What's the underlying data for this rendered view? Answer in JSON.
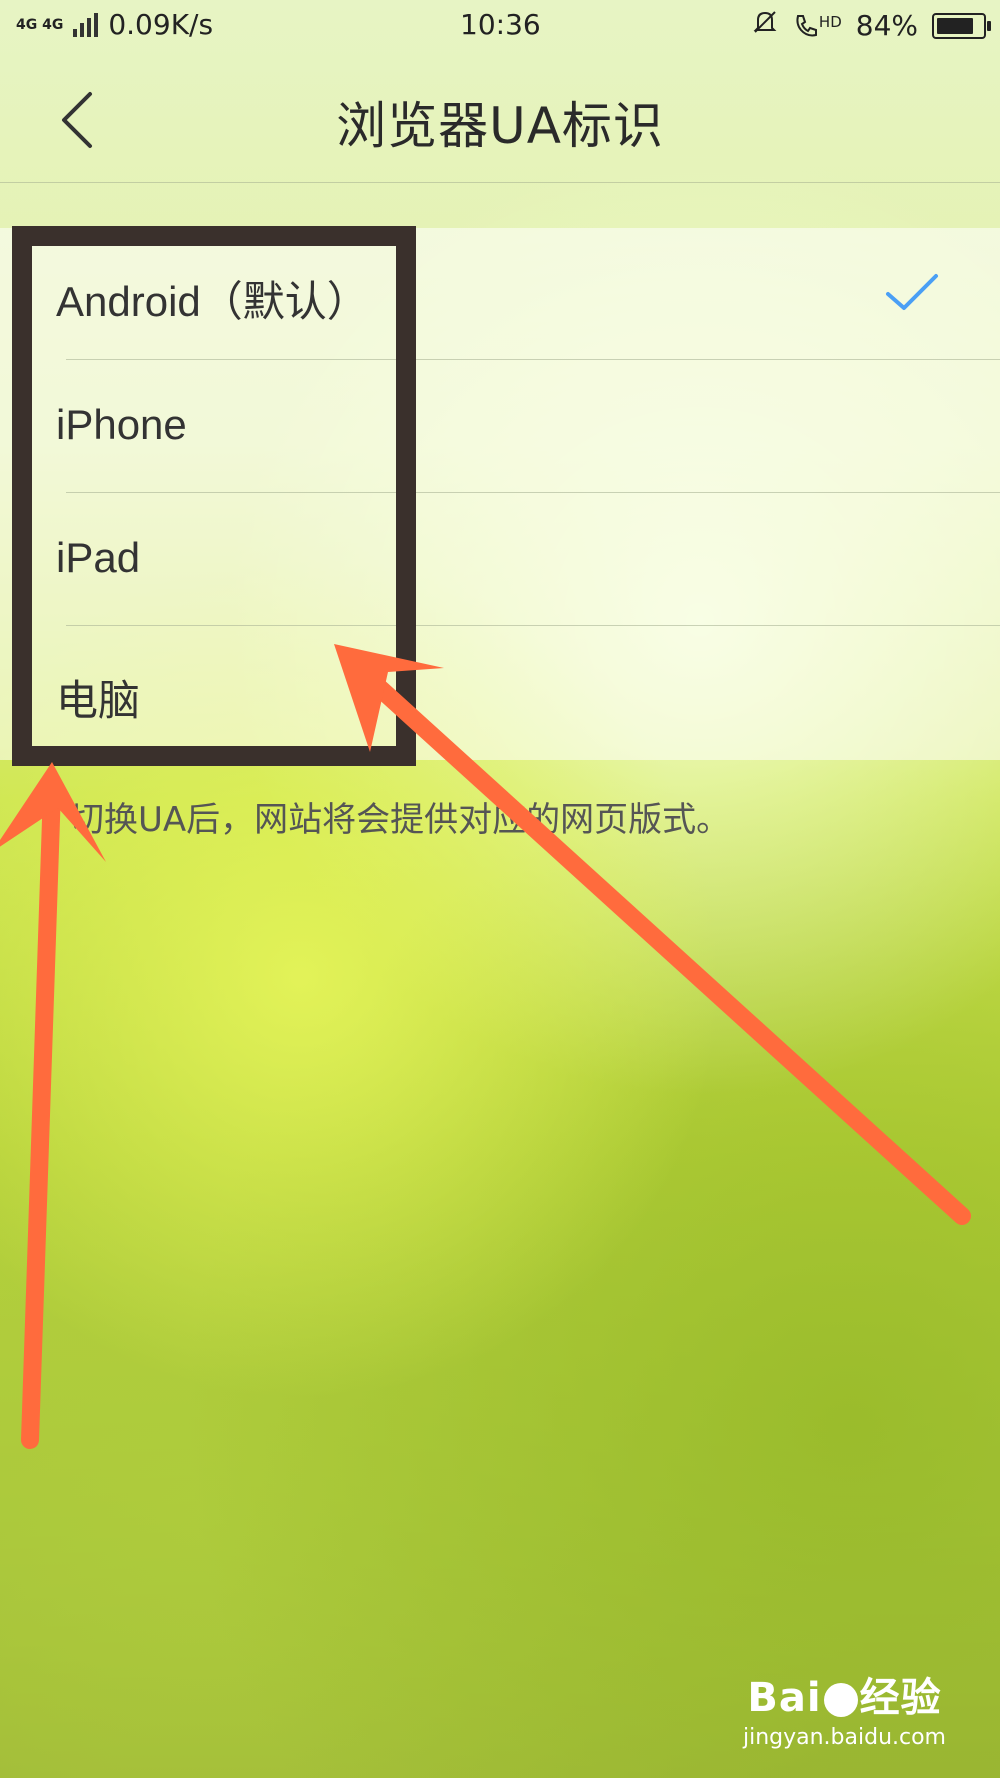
{
  "status_bar": {
    "network": "4G 4G",
    "speed": "0.09K/s",
    "time": "10:36",
    "hd": "HD",
    "battery": "84%",
    "battery_level": 0.84
  },
  "header": {
    "back_icon": "chevron-left-icon",
    "title": "浏览器UA标识"
  },
  "ua_options": [
    {
      "label": "Android（默认）",
      "selected": true
    },
    {
      "label": "iPhone",
      "selected": false
    },
    {
      "label": "iPad",
      "selected": false
    },
    {
      "label": "电脑",
      "selected": false
    }
  ],
  "hint": "切换UA后，网站将会提供对应的网页版式。",
  "check_color": "#4a9ff5",
  "annotation_color": "#ff6b3d",
  "highlight_color": "#3a302c",
  "watermark": {
    "brand": "Bai",
    "brand_suffix": "经验",
    "url": "jingyan.baidu.com"
  }
}
